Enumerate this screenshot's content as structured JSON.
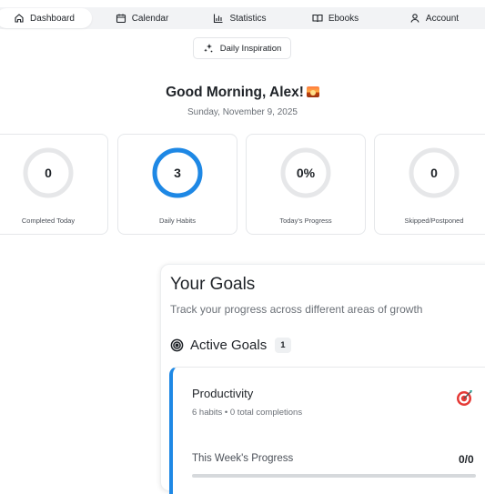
{
  "nav": {
    "tabs": [
      {
        "label": "Dashboard",
        "icon": "home-icon",
        "active": true
      },
      {
        "label": "Calendar",
        "icon": "calendar-icon"
      },
      {
        "label": "Statistics",
        "icon": "bar-chart-icon"
      },
      {
        "label": "Ebooks",
        "icon": "book-icon"
      },
      {
        "label": "Account",
        "icon": "user-icon"
      }
    ]
  },
  "inspiration": {
    "label": "Daily Inspiration",
    "icon": "sparkles-icon"
  },
  "greeting": {
    "text": "Good Morning, Alex!",
    "emoji": "sunrise-icon",
    "date": "Sunday, November 9, 2025"
  },
  "stats": [
    {
      "value": "0",
      "label": "Completed Today",
      "progress": 0
    },
    {
      "value": "3",
      "label": "Daily Habits",
      "progress": 1
    },
    {
      "value": "0%",
      "label": "Today's Progress",
      "progress": 0
    },
    {
      "value": "0",
      "label": "Skipped/Postponed",
      "progress": 0
    }
  ],
  "goals": {
    "title": "Your Goals",
    "subtitle": "Track your progress across different areas of growth",
    "active_label": "Active Goals",
    "active_count": "1",
    "items": [
      {
        "name": "Productivity",
        "meta": "6 habits • 0 total completions",
        "week_label": "This Week's Progress",
        "week_count": "0/0",
        "week_progress": 0,
        "accent": "#1e88e5"
      }
    ]
  },
  "colors": {
    "accent": "#1e88e5",
    "ring_track": "#e6e7e9"
  }
}
